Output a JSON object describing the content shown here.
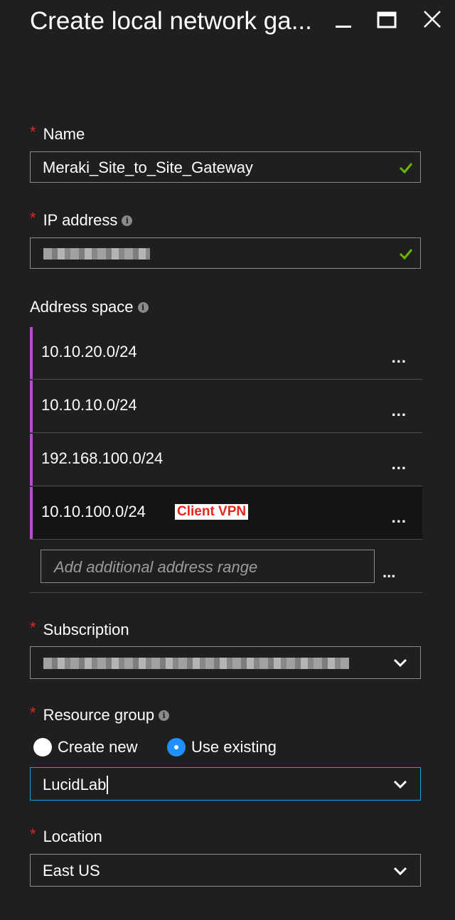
{
  "window": {
    "title": "Create local network ga...",
    "icons": {
      "minimize": "minimize-icon",
      "maximize": "maximize-icon",
      "close": "close-icon"
    }
  },
  "form": {
    "name": {
      "label": "Name",
      "required": true,
      "value": "Meraki_Site_to_Site_Gateway",
      "valid": true
    },
    "ip_address": {
      "label": "IP address",
      "required": true,
      "value_redacted": true,
      "valid": true
    },
    "address_space": {
      "label": "Address space",
      "rows": [
        {
          "value": "10.10.20.0/24",
          "menu": "..."
        },
        {
          "value": "10.10.10.0/24",
          "menu": "..."
        },
        {
          "value": "192.168.100.0/24",
          "menu": "..."
        },
        {
          "value": "10.10.100.0/24",
          "menu": "...",
          "annotation": "Client VPN"
        }
      ],
      "add_placeholder": "Add additional address range",
      "add_menu": "..."
    },
    "subscription": {
      "label": "Subscription",
      "required": true,
      "value_redacted": true
    },
    "resource_group": {
      "label": "Resource group",
      "required": true,
      "options": {
        "create_new": "Create new",
        "use_existing": "Use existing"
      },
      "selected": "use_existing",
      "value": "LucidLab"
    },
    "location": {
      "label": "Location",
      "required": true,
      "value": "East US"
    }
  },
  "colors": {
    "background": "#1f1f1f",
    "required_asterisk": "#e0281c",
    "valid_check": "#6bb700",
    "address_bar": "#b44fcb",
    "focus_border": "#1ea0e6",
    "radio_selected": "#1e90ff",
    "annotation_text": "#e8261b"
  }
}
